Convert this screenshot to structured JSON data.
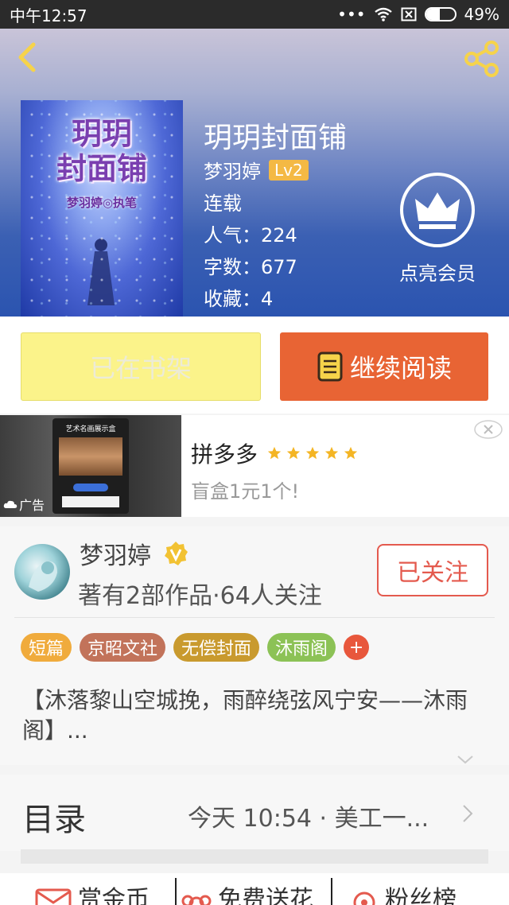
{
  "status_bar": {
    "time": "中午12:57",
    "battery": "49%",
    "battery_level": 0.49
  },
  "book": {
    "title": "玥玥封面铺",
    "author": "梦羽婷",
    "level": "Lv2",
    "status": "连载",
    "popularity": "人气：224",
    "word_count": "字数：677",
    "favorites": "收藏：4",
    "cover_title": "玥玥\n封面铺",
    "cover_subtitle": "梦羽婷◎执笔"
  },
  "vip": {
    "label": "点亮会员"
  },
  "actions": {
    "shelf_label": "已在书架",
    "read_label": "继续阅读"
  },
  "ad": {
    "title": "拼多多",
    "rating_stars": 5,
    "description": "盲盒1元1个!",
    "tag": "广告",
    "screen_title": "艺术名画展示盒"
  },
  "author_card": {
    "name": "梦羽婷",
    "stats": "著有2部作品·64人关注",
    "follow_label": "已关注",
    "tags": [
      {
        "label": "短篇",
        "color": "#f0ab3c"
      },
      {
        "label": "京昭文社",
        "color": "#c2735a"
      },
      {
        "label": "无偿封面",
        "color": "#c99a2e"
      },
      {
        "label": "沐雨阁",
        "color": "#8cc256"
      }
    ],
    "tag_more": "+",
    "description": "【沐落黎山空城挽，雨醉绕弦风宁安——沐雨阁】..."
  },
  "toc": {
    "label": "目录",
    "latest": "今天 10:54 · 美工一..."
  },
  "bottom_actions": {
    "reward": "赏金币",
    "flower": "免费送花",
    "fans": "粉丝榜"
  },
  "colors": {
    "accent_orange": "#e86434",
    "shelf_yellow": "#fbf38a",
    "follow_red": "#e45a4e",
    "lv_badge": "#f4b944"
  }
}
